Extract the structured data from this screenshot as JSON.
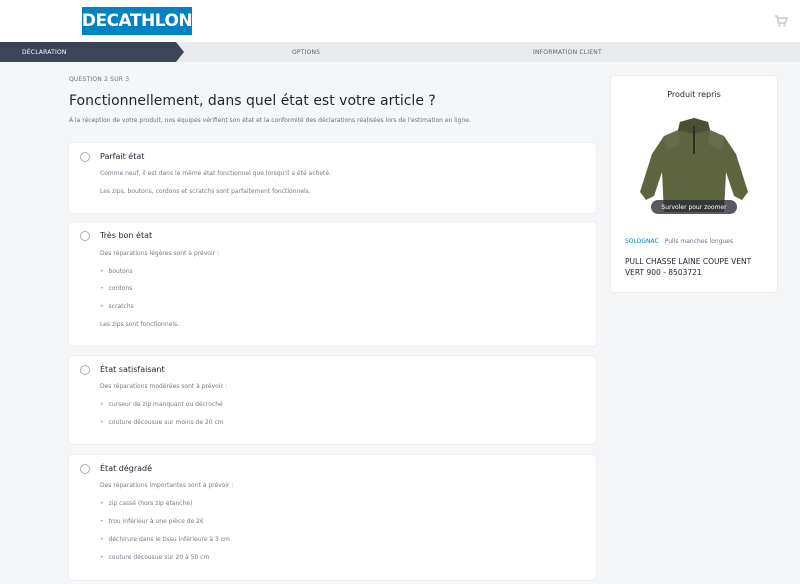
{
  "header": {
    "logo_text": "DECATHLON",
    "cart_icon": "shopping-cart-icon",
    "brand_color": "#0082c3"
  },
  "steps": [
    {
      "label": "DÉCLARATION",
      "active": true
    },
    {
      "label": "OPTIONS",
      "active": false
    },
    {
      "label": "INFORMATION CLIENT",
      "active": false
    }
  ],
  "question": {
    "counter": "QUESTION 2 SUR 3",
    "title": "Fonctionnellement, dans quel état est votre article ?",
    "subtitle": "À la réception de votre produit, nos équipes vérifient son état et la conformité des déclarations réalisées lors de l'estimation en ligne."
  },
  "options": [
    {
      "title": "Parfait état",
      "lines": [
        "Comme neuf, il est dans le même état fonctionnel que lorsqu'il a été acheté.",
        "Les zips, boutons, cordons et scratchs sont parfaitement fonctionnels."
      ]
    },
    {
      "title": "Très bon état",
      "intro": "Des réparations légères sont à prévoir :",
      "bullets": [
        "boutons",
        "cordons",
        "scratchs"
      ],
      "outro": "Les zips sont fonctionnels."
    },
    {
      "title": "État satisfaisant",
      "intro": "Des réparations modérées sont à prévoir :",
      "bullets": [
        "curseur de zip manquant ou décroché",
        "couture décousue sur moins de 20 cm"
      ]
    },
    {
      "title": "État dégradé",
      "intro": "Des réparations importantes sont à prévoir :",
      "bullets": [
        "zip cassé (hors zip étanche)",
        "trou inférieur à une pièce de 2€",
        "déchirure dans le tissu inférieure à 3 cm",
        "couture décousue sur 20 à 50 cm"
      ]
    }
  ],
  "sidebar": {
    "title": "Produit repris",
    "zoom_label": "Survoler pour zoomer",
    "brand": "SOLOGNAC",
    "category": "Pulls manches longues",
    "product_name": "PULL CHASSE LAINE COUPE VENT VERT 900 - 8503721"
  }
}
